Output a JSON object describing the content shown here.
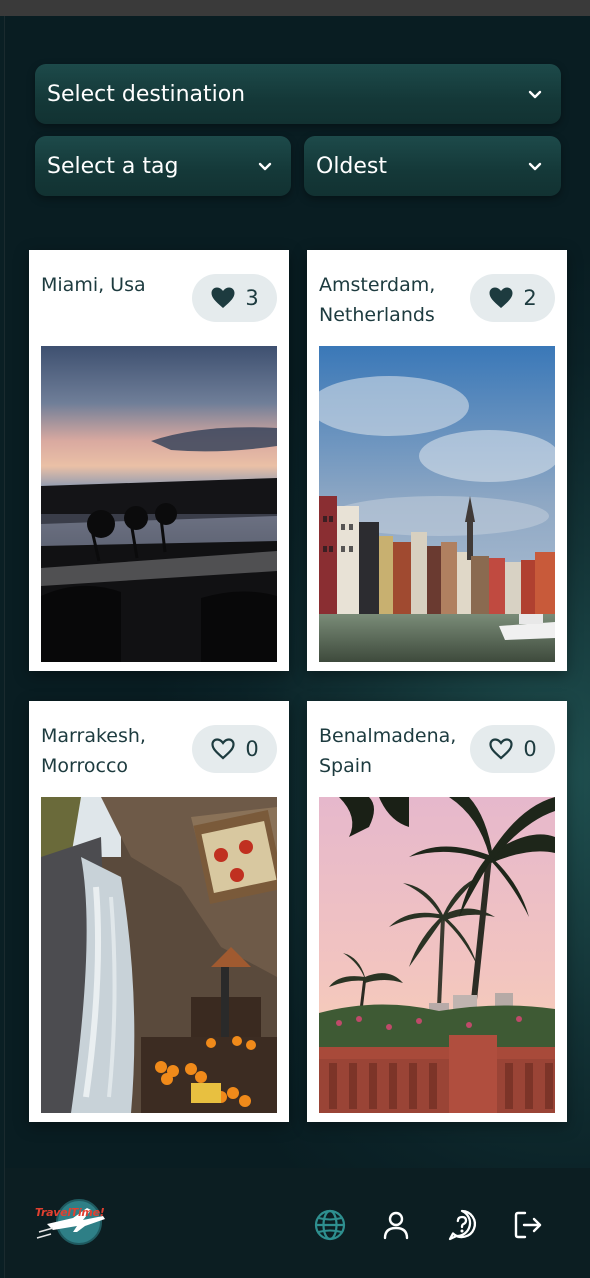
{
  "filters": {
    "destination_label": "Select destination",
    "tag_label": "Select a tag",
    "sort_label": "Oldest"
  },
  "posts": [
    {
      "place": "Miami, Usa",
      "likes": "3",
      "liked": true
    },
    {
      "place": "Amsterdam, Netherlands",
      "likes": "2",
      "liked": true
    },
    {
      "place": "Marrakesh, Morrocco",
      "likes": "0",
      "liked": false
    },
    {
      "place": "Benalmadena, Spain",
      "likes": "0",
      "liked": false
    }
  ],
  "footer": {
    "logo_text": "TravelTime!",
    "nav": [
      "globe-icon",
      "user-icon",
      "help-icon",
      "logout-icon"
    ],
    "active_nav": "globe-icon"
  },
  "colors": {
    "accent": "#2e8f8f",
    "card_text": "#1d3b3f",
    "select_bg": "#1a4444"
  }
}
